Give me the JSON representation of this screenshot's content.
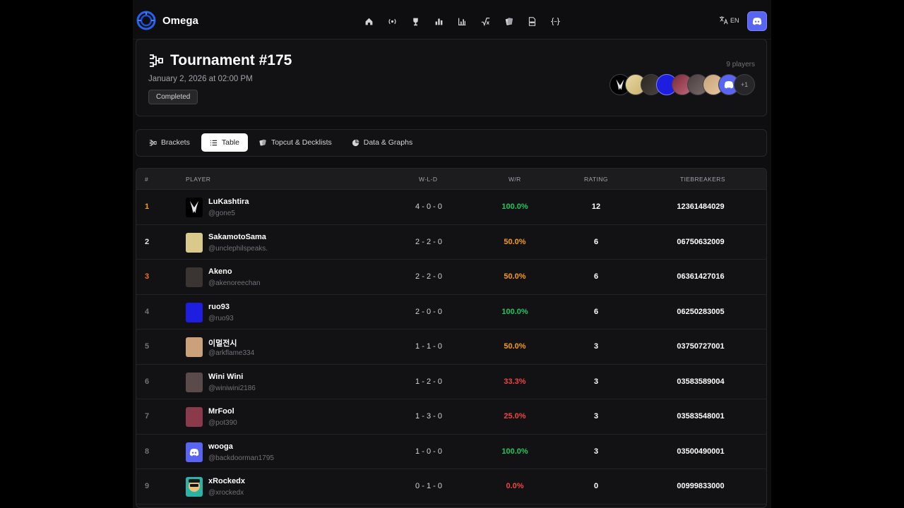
{
  "app": {
    "name": "Omega",
    "lang": "EN"
  },
  "nav": {
    "icons": [
      "home-icon",
      "broadcast-icon",
      "trophy-icon",
      "bar-chart-icon",
      "stats-chart-icon",
      "sqrt-icon",
      "cards-icon",
      "pdf-icon",
      "braces-icon"
    ]
  },
  "tournament": {
    "title": "Tournament #175",
    "date": "January 2, 2026 at 02:00 PM",
    "status": "Completed",
    "players_count": "9 players",
    "extra_players": "+1"
  },
  "tabs": [
    {
      "label": "Brackets",
      "icon": "bracket-icon"
    },
    {
      "label": "Table",
      "icon": "list-icon",
      "active": true
    },
    {
      "label": "Topcut & Decklists",
      "icon": "cards-icon"
    },
    {
      "label": "Data & Graphs",
      "icon": "pie-chart-icon"
    }
  ],
  "table": {
    "headers": {
      "rank": "#",
      "player": "PLAYER",
      "wld": "W-L-D",
      "wr": "W/R",
      "rating": "RATING",
      "tiebreakers": "TIEBREAKERS"
    },
    "rows": [
      {
        "rank": "1",
        "name": "LuKashtira",
        "handle": "@gone5",
        "wld": "4 - 0 - 0",
        "wr": "100.0%",
        "rating": "12",
        "tiebreakers": "12361484029",
        "rank_color": "#f59e0b",
        "wr_color": "#22c55e",
        "avatar": "#000000"
      },
      {
        "rank": "2",
        "name": "SakamotoSama",
        "handle": "@unclephilspeaks.",
        "wld": "2 - 2 - 0",
        "wr": "50.0%",
        "rating": "6",
        "tiebreakers": "06750632009",
        "rank_color": "#e4e4e7",
        "wr_color": "#f59e0b",
        "avatar": "#d9c98a"
      },
      {
        "rank": "3",
        "name": "Akeno",
        "handle": "@akenoreechan",
        "wld": "2 - 2 - 0",
        "wr": "50.0%",
        "rating": "6",
        "tiebreakers": "06361427016",
        "rank_color": "#f97316",
        "wr_color": "#f59e0b",
        "avatar": "#3a3533"
      },
      {
        "rank": "4",
        "name": "ruo93",
        "handle": "@ruo93",
        "wld": "2 - 0 - 0",
        "wr": "100.0%",
        "rating": "6",
        "tiebreakers": "06250283005",
        "rank_color": "#71717a",
        "wr_color": "#22c55e",
        "avatar": "#1e1ee0"
      },
      {
        "rank": "5",
        "name": "이멀전시",
        "handle": "@arkflame334",
        "wld": "1 - 1 - 0",
        "wr": "50.0%",
        "rating": "3",
        "tiebreakers": "03750727001",
        "rank_color": "#71717a",
        "wr_color": "#f59e0b",
        "avatar": "#c9a27a"
      },
      {
        "rank": "6",
        "name": "Wini Wini",
        "handle": "@winiwini2186",
        "wld": "1 - 2 - 0",
        "wr": "33.3%",
        "rating": "3",
        "tiebreakers": "03583589004",
        "rank_color": "#71717a",
        "wr_color": "#ef4444",
        "avatar": "#5a4a4a"
      },
      {
        "rank": "7",
        "name": "MrFool",
        "handle": "@pot390",
        "wld": "1 - 3 - 0",
        "wr": "25.0%",
        "rating": "3",
        "tiebreakers": "03583548001",
        "rank_color": "#71717a",
        "wr_color": "#ef4444",
        "avatar": "#8a3a4a"
      },
      {
        "rank": "8",
        "name": "wooga",
        "handle": "@backdoorman1795",
        "wld": "1 - 0 - 0",
        "wr": "100.0%",
        "rating": "3",
        "tiebreakers": "03500490001",
        "rank_color": "#71717a",
        "wr_color": "#22c55e",
        "avatar": "#5865f2"
      },
      {
        "rank": "9",
        "name": "xRockedx",
        "handle": "@xrockedx",
        "wld": "0 - 1 - 0",
        "wr": "0.0%",
        "rating": "0",
        "tiebreakers": "00999833000",
        "rank_color": "#71717a",
        "wr_color": "#ef4444",
        "avatar": "#2ab3a6"
      }
    ]
  },
  "colors": {
    "accent": "#5865f2",
    "win": "#22c55e",
    "mid": "#f59e0b",
    "loss": "#ef4444"
  }
}
